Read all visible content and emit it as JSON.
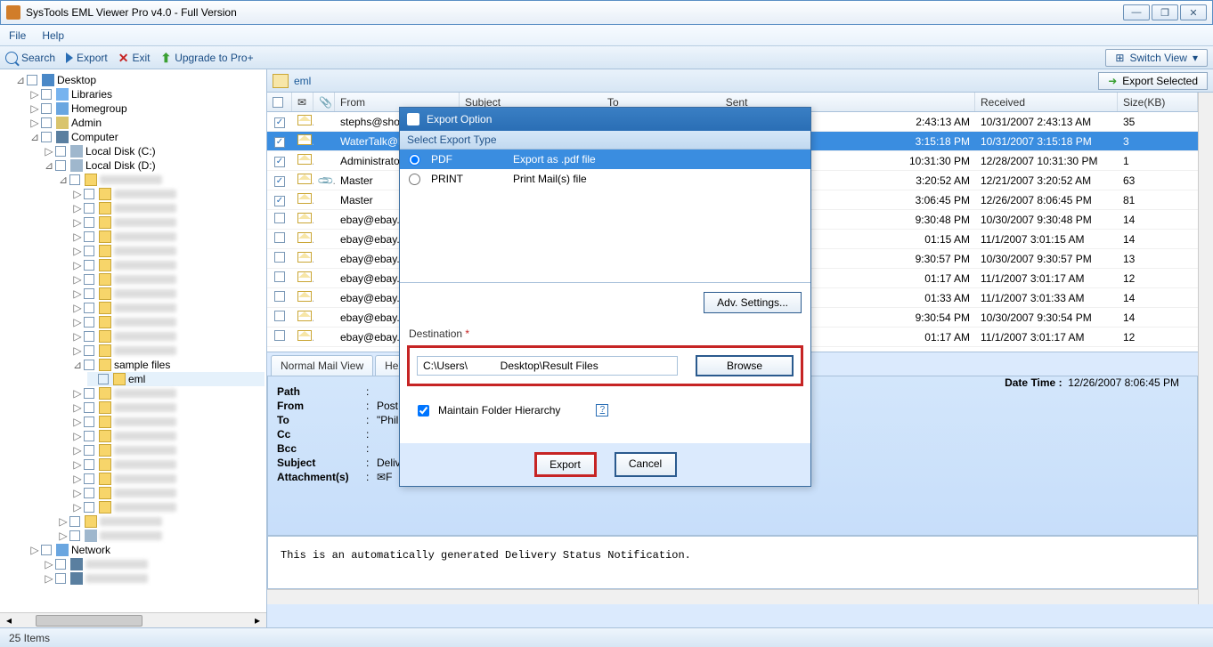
{
  "window_title": "SysTools EML Viewer Pro v4.0 - Full Version",
  "menu": {
    "file": "File",
    "help": "Help"
  },
  "toolbar": {
    "search": "Search",
    "export": "Export",
    "exit": "Exit",
    "upgrade": "Upgrade to Pro+",
    "switch": "Switch View",
    "export_selected": "Export Selected"
  },
  "tree": {
    "desktop": "Desktop",
    "libraries": "Libraries",
    "homegroup": "Homegroup",
    "admin": "Admin",
    "computer": "Computer",
    "disk_c": "Local Disk (C:)",
    "disk_d": "Local Disk (D:)",
    "sample_files": "sample files",
    "eml": "eml",
    "network": "Network"
  },
  "breadcrumb": "eml",
  "columns": {
    "from": "From",
    "subject": "Subject",
    "to": "To",
    "sent": "Sent",
    "received": "Received",
    "size": "Size(KB)"
  },
  "rows": [
    {
      "chk": true,
      "att": false,
      "from": "stephs@shoals",
      "sent": "2:43:13 AM",
      "recv": "10/31/2007 2:43:13 AM",
      "size": "35"
    },
    {
      "chk": true,
      "att": false,
      "from": "WaterTalk@list",
      "sent": "3:15:18 PM",
      "recv": "10/31/2007 3:15:18 PM",
      "size": "3",
      "sel": true
    },
    {
      "chk": true,
      "att": false,
      "from": "Administrator",
      "sent": "10:31:30 PM",
      "recv": "12/28/2007 10:31:30 PM",
      "size": "1"
    },
    {
      "chk": true,
      "att": true,
      "from": "Master",
      "sent": "3:20:52 AM",
      "recv": "12/21/2007 3:20:52 AM",
      "size": "63"
    },
    {
      "chk": true,
      "att": false,
      "from": "Master",
      "sent": "3:06:45 PM",
      "recv": "12/26/2007 8:06:45 PM",
      "size": "81"
    },
    {
      "chk": false,
      "att": false,
      "from": "ebay@ebay.cor",
      "sent": "9:30:48 PM",
      "recv": "10/30/2007 9:30:48 PM",
      "size": "14"
    },
    {
      "chk": false,
      "att": false,
      "from": "ebay@ebay.cor",
      "sent": "01:15 AM",
      "recv": "11/1/2007 3:01:15 AM",
      "size": "14"
    },
    {
      "chk": false,
      "att": false,
      "from": "ebay@ebay.cor",
      "sent": "9:30:57 PM",
      "recv": "10/30/2007 9:30:57 PM",
      "size": "13"
    },
    {
      "chk": false,
      "att": false,
      "from": "ebay@ebay.cor",
      "sent": "01:17 AM",
      "recv": "11/1/2007 3:01:17 AM",
      "size": "12"
    },
    {
      "chk": false,
      "att": false,
      "from": "ebay@ebay.cor",
      "sent": "01:33 AM",
      "recv": "11/1/2007 3:01:33 AM",
      "size": "14"
    },
    {
      "chk": false,
      "att": false,
      "from": "ebay@ebay.cor",
      "sent": "9:30:54 PM",
      "recv": "10/30/2007 9:30:54 PM",
      "size": "14"
    },
    {
      "chk": false,
      "att": false,
      "from": "ebay@ebay.cor",
      "sent": "01:17 AM",
      "recv": "11/1/2007 3:01:17 AM",
      "size": "12"
    }
  ],
  "tabs": {
    "normal": "Normal Mail View",
    "hex": "Hex"
  },
  "preview": {
    "path_lbl": "Path",
    "from_lbl": "From",
    "to_lbl": "To",
    "cc_lbl": "Cc",
    "bcc_lbl": "Bcc",
    "subject_lbl": "Subject",
    "attach_lbl": "Attachment(s)",
    "from_val": "Post",
    "to_val": "\"Phill",
    "subject_val": "Deliv",
    "attach_val": "F",
    "datetime_lbl": "Date Time  :",
    "datetime_val": "12/26/2007 8:06:45 PM"
  },
  "body_text": "This is an automatically generated Delivery Status Notification.",
  "status": "25 Items",
  "dialog": {
    "title": "Export Option",
    "select_type": "Select Export Type",
    "pdf": "PDF",
    "pdf_desc": "Export as .pdf file",
    "print": "PRINT",
    "print_desc": "Print Mail(s) file",
    "adv": "Adv. Settings...",
    "dest_lbl": "Destination",
    "dest_val": "C:\\Users\\           Desktop\\Result Files",
    "browse": "Browse",
    "maintain": "Maintain Folder Hierarchy",
    "help": "?",
    "export": "Export",
    "cancel": "Cancel"
  }
}
